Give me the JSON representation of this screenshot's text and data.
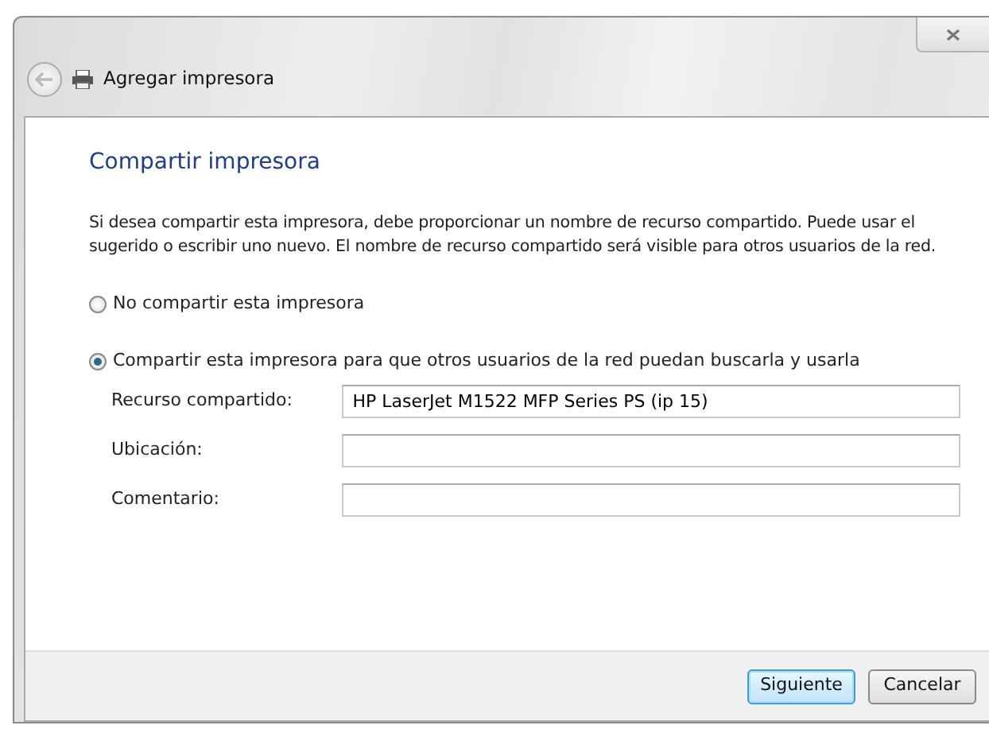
{
  "window": {
    "title": "Agregar impresora"
  },
  "heading": "Compartir impresora",
  "description": "Si desea compartir esta impresora, debe proporcionar un nombre de recurso compartido. Puede usar el sugerido o escribir uno nuevo. El nombre de recurso compartido será visible para otros usuarios de la red.",
  "options": [
    {
      "label": "No compartir esta impresora",
      "selected": false
    },
    {
      "label": "Compartir esta impresora para que otros usuarios de la red puedan buscarla y usarla",
      "selected": true
    }
  ],
  "fields": [
    {
      "label": "Recurso compartido:",
      "value": "HP LaserJet M1522 MFP Series PS (ip 15)"
    },
    {
      "label": "Ubicación:"
    },
    {
      "label": "Comentario:"
    }
  ],
  "buttons": [
    {
      "label": "Siguiente",
      "default": true
    },
    {
      "label": "Cancelar",
      "default": false
    }
  ]
}
